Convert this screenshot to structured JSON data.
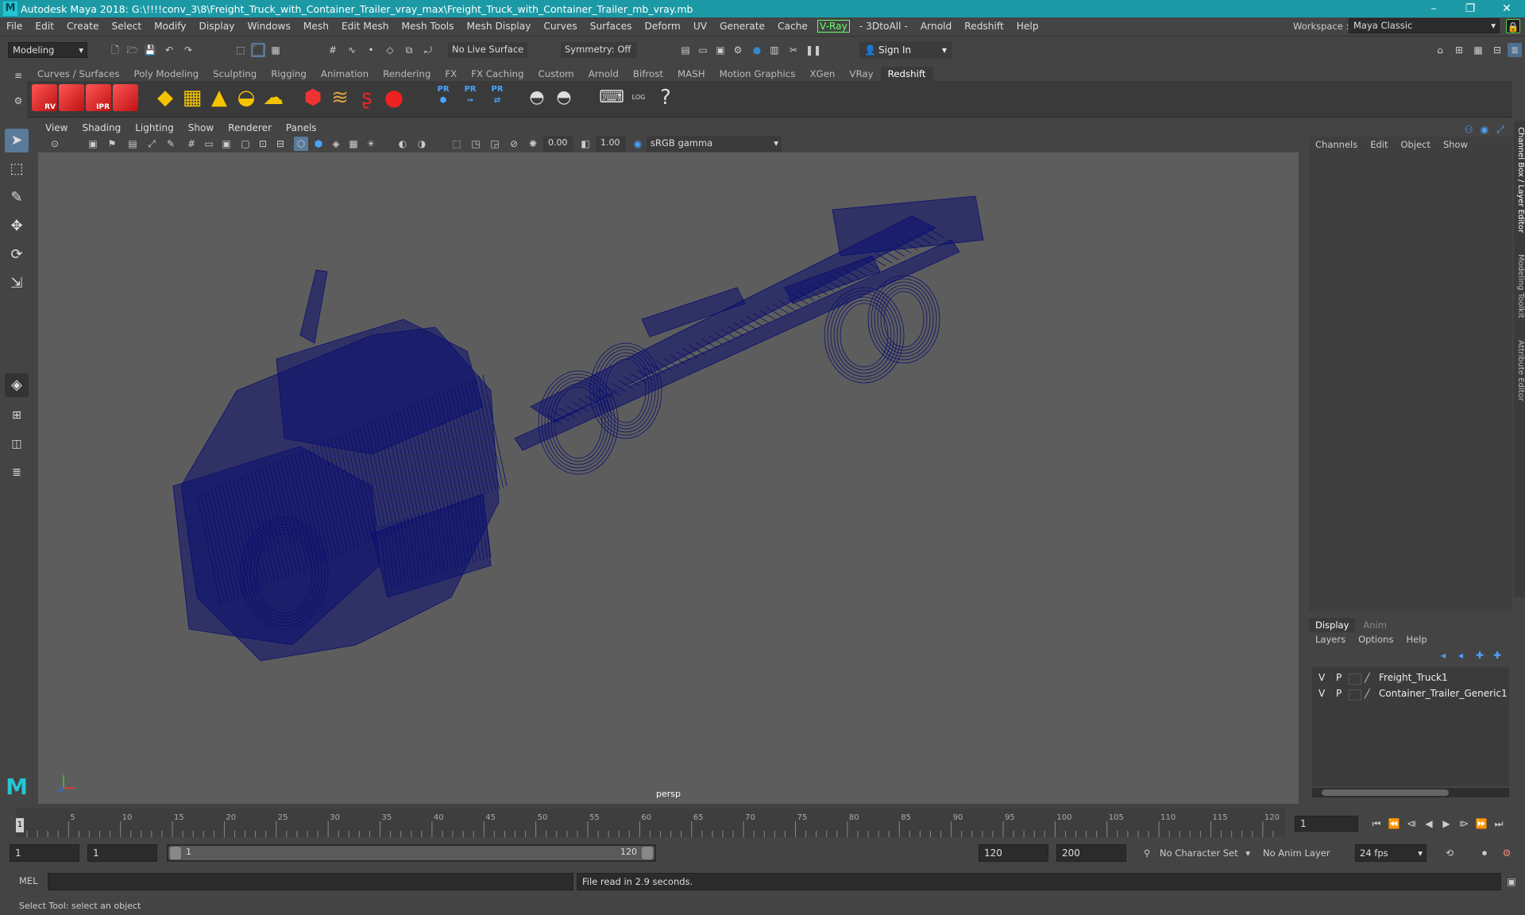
{
  "title_bar": {
    "title": "Autodesk Maya 2018: G:\\!!!!conv_3\\8\\Freight_Truck_with_Container_Trailer_vray_max\\Freight_Truck_with_Container_Trailer_mb_vray.mb",
    "logo": "M"
  },
  "menu": [
    "File",
    "Edit",
    "Create",
    "Select",
    "Modify",
    "Display",
    "Windows",
    "Mesh",
    "Edit Mesh",
    "Mesh Tools",
    "Mesh Display",
    "Curves",
    "Surfaces",
    "Deform",
    "UV",
    "Generate",
    "Cache",
    "V-Ray",
    "- 3DtoAll -",
    "Arnold",
    "Redshift",
    "Help"
  ],
  "workspace": {
    "label": "Workspace :",
    "value": "Maya Classic"
  },
  "status_line": {
    "menu_set": "Modeling",
    "live_surface": "No Live Surface",
    "symmetry": "Symmetry: Off",
    "sign_in": "Sign In"
  },
  "shelf_tabs": [
    "Curves / Surfaces",
    "Poly Modeling",
    "Sculpting",
    "Rigging",
    "Animation",
    "Rendering",
    "FX",
    "FX Caching",
    "Custom",
    "Arnold",
    "Bifrost",
    "MASH",
    "Motion Graphics",
    "XGen",
    "VRay",
    "Redshift"
  ],
  "active_shelf": "Redshift",
  "shelf_icon_labels": {
    "rv": "RV",
    "ipr": "IPR",
    "pr": "PR",
    "log": "LOG",
    "help": "?"
  },
  "viewport_menu": [
    "View",
    "Shading",
    "Lighting",
    "Show",
    "Renderer",
    "Panels"
  ],
  "viewport_toolbar": {
    "exposure": "0.00",
    "gamma": "1.00",
    "color_space": "sRGB gamma"
  },
  "viewport": {
    "camera_label": "persp",
    "mesh_color": "#0b0f6e",
    "bg_color": "#5d5d5d"
  },
  "channel_box": {
    "tabs": [
      "Channels",
      "Edit",
      "Object",
      "Show"
    ]
  },
  "side_tabs": [
    "Channel Box / Layer Editor",
    "Modeling Toolkit",
    "Attribute Editor"
  ],
  "layer_editor": {
    "tabs": [
      "Display",
      "Anim"
    ],
    "menu": [
      "Layers",
      "Options",
      "Help"
    ],
    "layers": [
      {
        "v": "V",
        "p": "P",
        "name": "Freight_Truck1"
      },
      {
        "v": "V",
        "p": "P",
        "name": "Container_Trailer_Generic1"
      }
    ]
  },
  "timeline": {
    "ticks": [
      "5",
      "10",
      "15",
      "20",
      "25",
      "30",
      "35",
      "40",
      "45",
      "50",
      "55",
      "60",
      "65",
      "70",
      "75",
      "80",
      "85",
      "90",
      "95",
      "100",
      "105",
      "110",
      "115",
      "120"
    ],
    "start_marker": "1",
    "current_frame": "1"
  },
  "range": {
    "start": "1",
    "playback_start": "1",
    "slider_start": "1",
    "slider_end": "120",
    "playback_end": "120",
    "end": "200",
    "character_set": "No Character Set",
    "anim_layer": "No Anim Layer",
    "fps": "24 fps"
  },
  "command": {
    "language": "MEL",
    "result": "File read in  2.9 seconds."
  },
  "help_line": "Select Tool: select an object"
}
